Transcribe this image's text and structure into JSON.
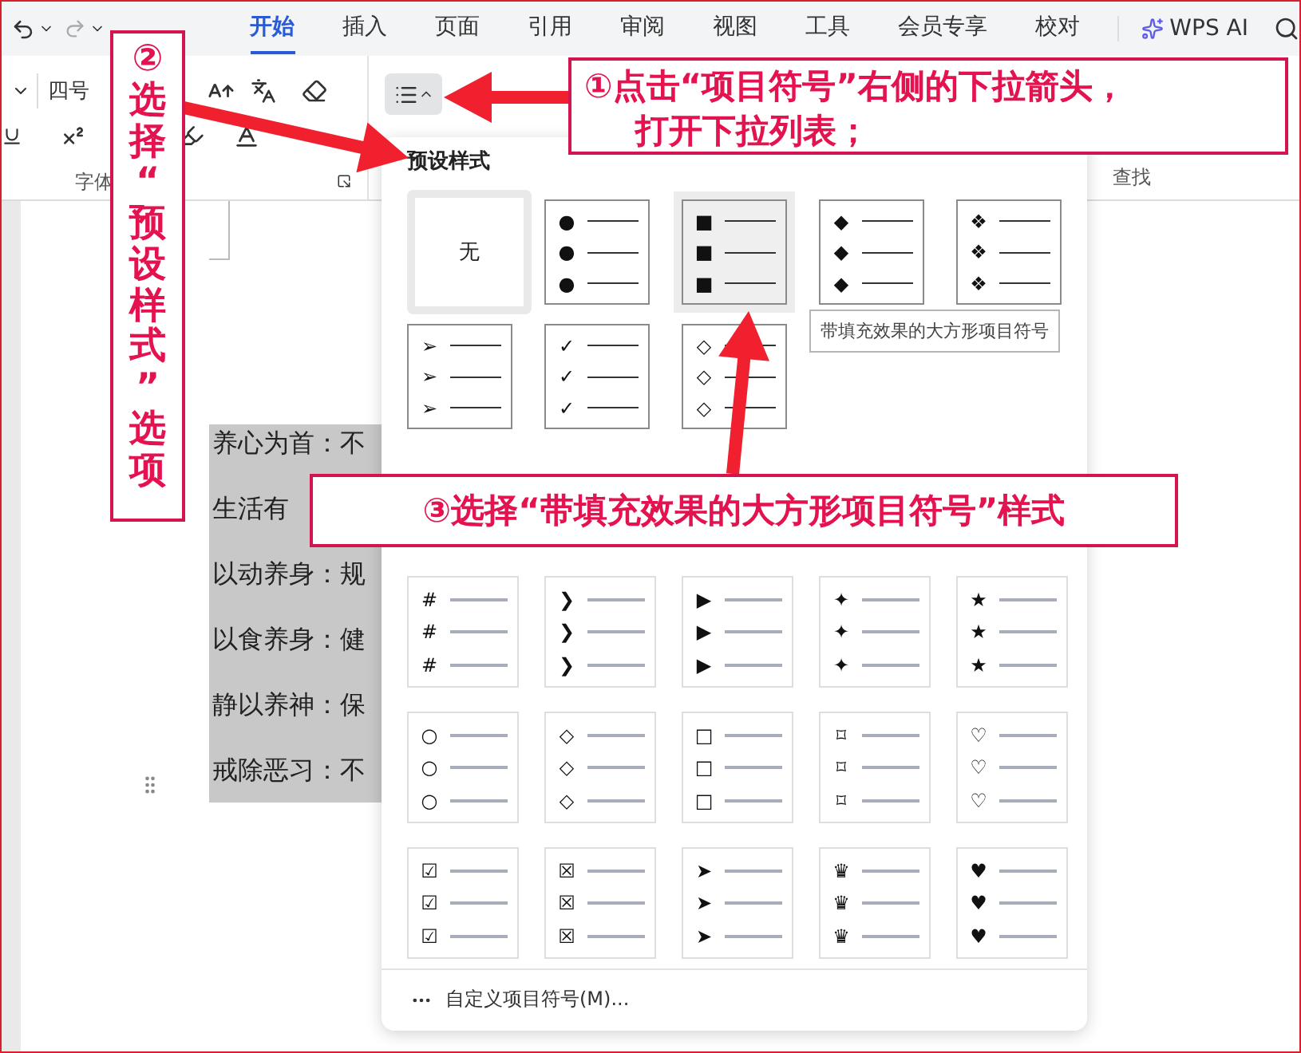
{
  "ribbon": {
    "tabs": [
      {
        "label": "开始",
        "selected": true
      },
      {
        "label": "插入",
        "selected": false
      },
      {
        "label": "页面",
        "selected": false
      },
      {
        "label": "引用",
        "selected": false
      },
      {
        "label": "审阅",
        "selected": false
      },
      {
        "label": "视图",
        "selected": false
      },
      {
        "label": "工具",
        "selected": false
      },
      {
        "label": "会员专享",
        "selected": false
      },
      {
        "label": "校对",
        "selected": false
      }
    ],
    "ai_button": "WPS AI",
    "font_size": "四号",
    "font_group_label": "字体",
    "bullet_button": {
      "expanded": true
    },
    "find_label": "查找"
  },
  "document": {
    "lines": [
      "养心为首：不",
      "生活有",
      "以动养身：规",
      "以食养身：健",
      "静以养神：保",
      "戒除恶习：不"
    ]
  },
  "bullet_menu": {
    "title": "预设样式",
    "presets": [
      {
        "kind": "none",
        "label": "无",
        "selected": false
      },
      {
        "kind": "bullet",
        "glyph": "●",
        "selected": false
      },
      {
        "kind": "bullet",
        "glyph": "■",
        "selected": true
      },
      {
        "kind": "bullet",
        "glyph": "◆",
        "selected": false
      },
      {
        "kind": "bullet",
        "glyph": "❖",
        "selected": false
      },
      {
        "kind": "bullet",
        "glyph": "➢",
        "selected": false
      },
      {
        "kind": "bullet",
        "glyph": "✓",
        "selected": false
      },
      {
        "kind": "bullet",
        "glyph": "◇",
        "selected": false
      }
    ],
    "tooltip": "带填充效果的大方形项目符号",
    "more": [
      {
        "glyph": "#",
        "selected": false
      },
      {
        "glyph": "❯",
        "selected": false
      },
      {
        "glyph": "▶",
        "selected": false
      },
      {
        "glyph": "✦",
        "selected": false
      },
      {
        "glyph": "★",
        "selected": false
      },
      {
        "glyph": "○",
        "selected": false
      },
      {
        "glyph": "◇",
        "selected": false
      },
      {
        "glyph": "□",
        "selected": false
      },
      {
        "glyph": "⌑",
        "selected": false
      },
      {
        "glyph": "♡",
        "selected": false
      },
      {
        "glyph": "☑",
        "selected": false
      },
      {
        "glyph": "☒",
        "selected": false
      },
      {
        "glyph": "➤",
        "selected": false
      },
      {
        "glyph": "♛",
        "selected": false
      },
      {
        "glyph": "♥",
        "selected": false
      }
    ],
    "custom_option": "自定义项目符号(M)..."
  },
  "annotations": [
    {
      "kind": "column",
      "lines": [
        "②选择“预设样式”选项"
      ]
    },
    {
      "kind": "box",
      "lines": [
        "①点击“项目符号”右侧的下拉箭头，",
        "打开下拉列表；"
      ]
    },
    {
      "kind": "banner",
      "lines": [
        "③选择“带填充效果的大方形项目符号”样式"
      ]
    }
  ]
}
